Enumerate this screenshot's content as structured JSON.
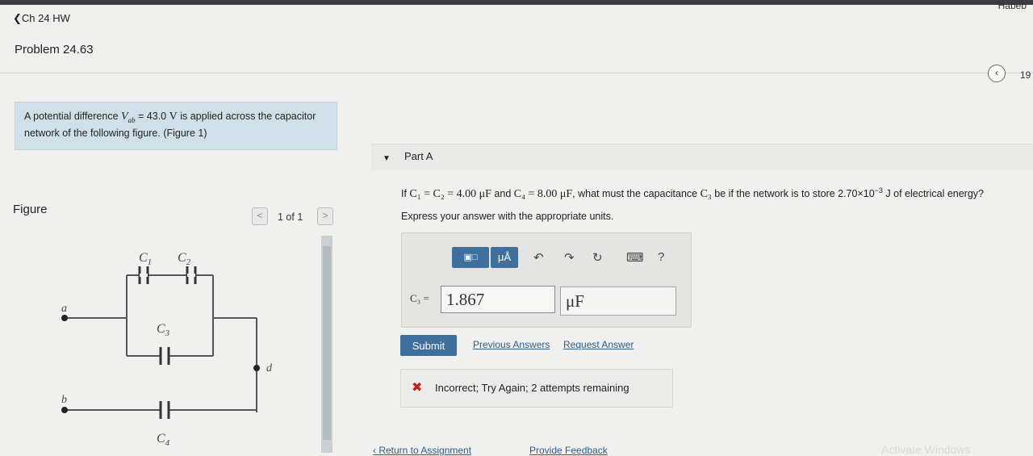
{
  "header": {
    "user_name": "Habeb",
    "back_link": "Ch 24 HW",
    "problem_title": "Problem 24.63",
    "page_number": "19"
  },
  "problem": {
    "text_prefix": "A potential difference ",
    "var_main": "V",
    "var_sub": "ab",
    "text_value": " = 43.0 ",
    "unit": "V",
    "text_suffix": " is applied across the capacitor network of the following figure. ",
    "figure_link": "(Figure 1)"
  },
  "figure": {
    "label": "Figure",
    "counter": "1 of 1",
    "prev_symbol": "<",
    "next_symbol": ">",
    "labels": {
      "c1": "C",
      "c1_sub": "1",
      "c2": "C",
      "c2_sub": "2",
      "c3": "C",
      "c3_sub": "3",
      "c4": "C",
      "c4_sub": "4",
      "a": "a",
      "b": "b",
      "d": "d"
    }
  },
  "part_a": {
    "title": "Part A",
    "q_if": "If ",
    "q_eq": "C₁ = C₂ = 4.00 μF",
    "q_and": " and ",
    "q_c4": "C₄ = 8.00 μF",
    "q_rest": ", what must the capacitance ",
    "q_c3": "C₃",
    "q_end": " be if the network is to store 2.70×10",
    "q_exp": "−3",
    "q_tail": " J of electrical energy?",
    "instruction": "Express your answer with the appropriate units."
  },
  "toolbar": {
    "units_label": "μÅ",
    "undo": "↶",
    "redo": "↷",
    "reset": "↻",
    "keyboard": "⌨",
    "help": "?"
  },
  "answer": {
    "label": "C₃ =",
    "value": "1.867",
    "unit": "μF"
  },
  "actions": {
    "submit_label": "Submit",
    "previous_answers": "Previous Answers",
    "request_answer": "Request Answer"
  },
  "feedback": {
    "icon": "✖",
    "text": "Incorrect; Try Again; 2 attempts remaining"
  },
  "footer": {
    "return_link": "‹ Return to Assignment",
    "provide_feedback": "Provide Feedback",
    "activate_hint": "Activate Windows"
  }
}
